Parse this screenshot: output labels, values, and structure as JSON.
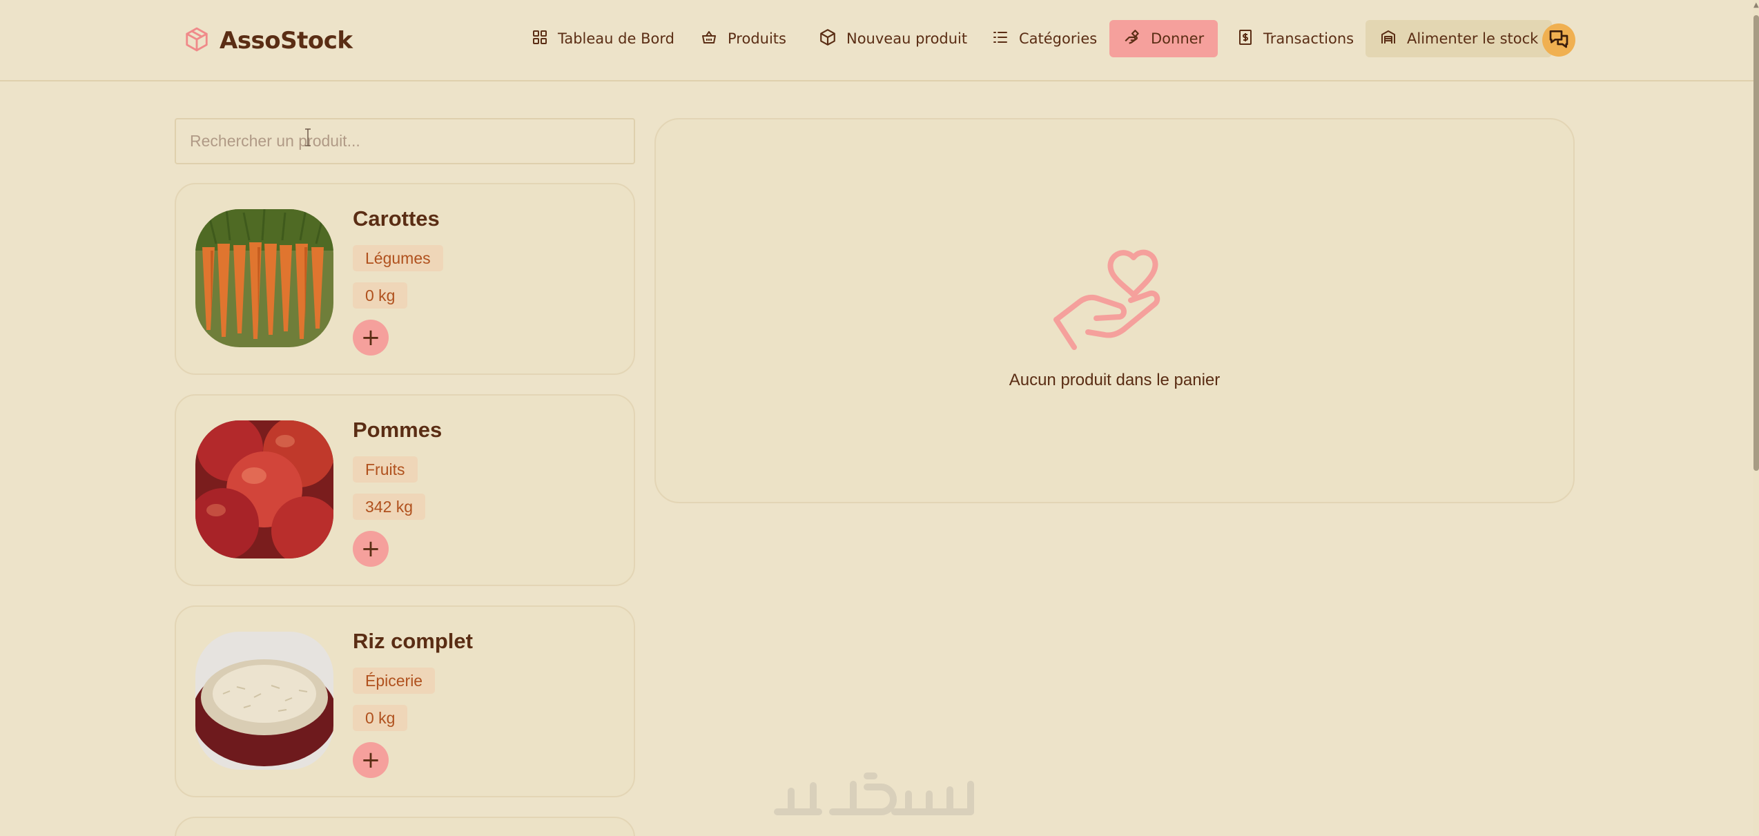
{
  "app": {
    "name": "AssoStock"
  },
  "nav": [
    {
      "id": "dashboard",
      "label": "Tableau de Bord",
      "icon": "dashboard-icon"
    },
    {
      "id": "products",
      "label": "Produits",
      "icon": "basket-icon"
    },
    {
      "id": "new-product",
      "label": "Nouveau produit",
      "icon": "package-icon"
    },
    {
      "id": "categories",
      "label": "Catégories",
      "icon": "list-icon"
    },
    {
      "id": "donate",
      "label": "Donner",
      "icon": "hand-heart-icon",
      "active": true
    },
    {
      "id": "transactions",
      "label": "Transactions",
      "icon": "dollar-icon"
    },
    {
      "id": "restock",
      "label": "Alimenter le stock",
      "icon": "warehouse-icon"
    }
  ],
  "search": {
    "placeholder": "Rechercher un produit...",
    "value": ""
  },
  "products": [
    {
      "name": "Carottes",
      "category": "Légumes",
      "stock": "0 kg",
      "image": "carrots-image"
    },
    {
      "name": "Pommes",
      "category": "Fruits",
      "stock": "342 kg",
      "image": "apples-image"
    },
    {
      "name": "Riz complet",
      "category": "Épicerie",
      "stock": "0 kg",
      "image": "rice-image"
    }
  ],
  "add_label": "+",
  "cart": {
    "empty_message": "Aucun produit dans le panier",
    "icon": "hand-heart-icon"
  },
  "colors": {
    "background": "#ede3c9",
    "text": "#5a2d14",
    "accent": "#f5a09c",
    "tag_bg": "#efd6b8",
    "tag_text": "#b0511e",
    "chat": "#f0b051"
  }
}
